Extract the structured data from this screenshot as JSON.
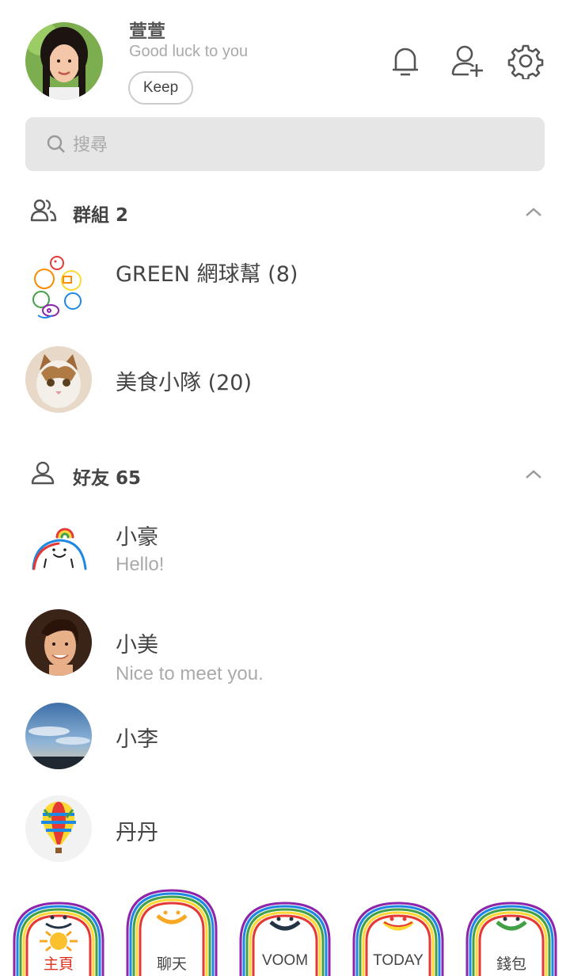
{
  "profile": {
    "name": "萱萱",
    "status": "Good luck to you",
    "keep_label": "Keep"
  },
  "search": {
    "placeholder": "搜尋"
  },
  "groups": {
    "title": "群組 2",
    "items": [
      {
        "name": "GREEN 網球幫 (8)"
      },
      {
        "name": "美食小隊 (20)"
      }
    ]
  },
  "friends": {
    "title": "好友 65",
    "items": [
      {
        "name": "小豪",
        "message": "Hello!"
      },
      {
        "name": "小美",
        "message": "Nice to meet you."
      },
      {
        "name": "小李",
        "message": ""
      },
      {
        "name": "丹丹",
        "message": ""
      }
    ]
  },
  "nav": {
    "tabs": [
      {
        "label": "主頁",
        "active": true
      },
      {
        "label": "聊天",
        "active": false
      },
      {
        "label": "VOOM",
        "active": false
      },
      {
        "label": "TODAY",
        "active": false
      },
      {
        "label": "錢包",
        "active": false
      }
    ]
  },
  "colors": {
    "active_tab": "#e0301e",
    "search_bg": "#e6e6e6"
  }
}
